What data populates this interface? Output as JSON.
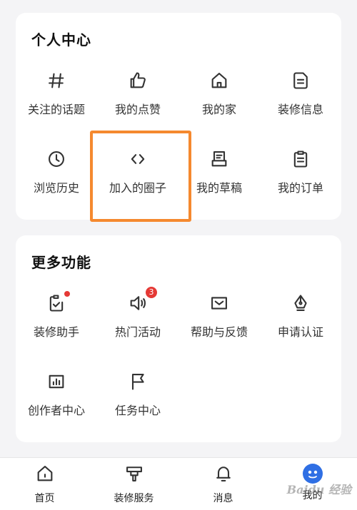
{
  "personal_center": {
    "title": "个人中心",
    "items": [
      {
        "label": "关注的话题",
        "icon": "hashtag-icon"
      },
      {
        "label": "我的点赞",
        "icon": "thumbs-up-icon"
      },
      {
        "label": "我的家",
        "icon": "home-icon"
      },
      {
        "label": "装修信息",
        "icon": "document-icon"
      },
      {
        "label": "浏览历史",
        "icon": "clock-icon"
      },
      {
        "label": "加入的圈子",
        "icon": "code-brackets-icon"
      },
      {
        "label": "我的草稿",
        "icon": "draft-icon"
      },
      {
        "label": "我的订单",
        "icon": "clipboard-icon"
      }
    ]
  },
  "more_functions": {
    "title": "更多功能",
    "items": [
      {
        "label": "装修助手",
        "icon": "checklist-icon",
        "dot": true
      },
      {
        "label": "热门活动",
        "icon": "speaker-icon",
        "badge": "3"
      },
      {
        "label": "帮助与反馈",
        "icon": "mail-icon"
      },
      {
        "label": "申请认证",
        "icon": "pen-nib-icon"
      },
      {
        "label": "创作者中心",
        "icon": "bar-chart-icon"
      },
      {
        "label": "任务中心",
        "icon": "flag-icon"
      }
    ]
  },
  "tabbar": {
    "items": [
      {
        "label": "首页",
        "icon": "home-tab-icon"
      },
      {
        "label": "装修服务",
        "icon": "service-icon"
      },
      {
        "label": "消息",
        "icon": "bell-icon"
      },
      {
        "label": "我的",
        "icon": "profile-avatar-icon",
        "active": true
      }
    ]
  },
  "watermark": "Baidu 经验",
  "colors": {
    "highlight": "#f5892f",
    "badge": "#e53935",
    "accent": "#2f6fe4"
  }
}
